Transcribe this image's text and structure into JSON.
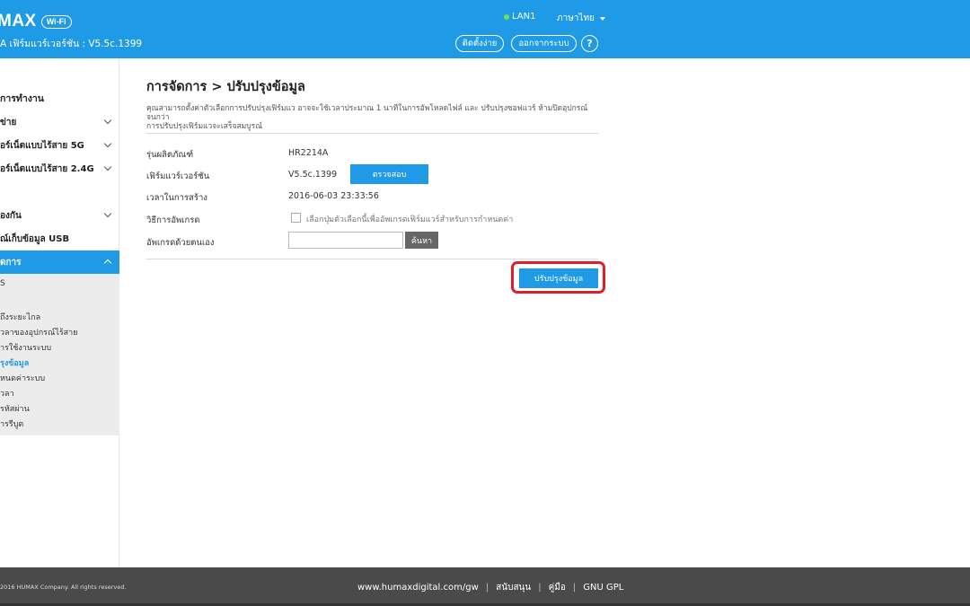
{
  "header": {
    "logo": "HUMAX",
    "logo_visible": "MAX",
    "wifi_badge": "Wi-Fi",
    "firmware_line": "A เฟิร์มแวร์เวอร์ชัน : V5.5c.1399",
    "lan_label": "LAN1",
    "language": "ภาษาไทย",
    "setup_button": "ติดตั้งง่าย",
    "logout_button": "ออกจากระบบ",
    "help_button": "?",
    "colors": {
      "primary": "#1e9ae6",
      "lan_status": "#6ee24a"
    }
  },
  "sidebar": {
    "group_title": "การทำงาน",
    "items": [
      {
        "label": "ข่าย"
      },
      {
        "label": "อร์เน็ตแบบไร้สาย 5G"
      },
      {
        "label": "อร์เน็ตแบบไร้สาย 2.4G"
      },
      {
        "label": "องกัน"
      },
      {
        "label": "ณ์เก็บข้อมูล USB"
      },
      {
        "label": "ดการ"
      }
    ],
    "submenu": [
      "S",
      "",
      "ถึงระยะไกล",
      "วลาของอุปกรณ์ไร้สาย",
      "ารใช้งานระบบ",
      "รุงข้อมูล",
      "หนดค่าระบบ",
      "วลา",
      "รหัสผ่าน",
      "ารรีบูต"
    ]
  },
  "main": {
    "title": "การจัดการ > ปรับปรุงข้อมูล",
    "description_1": "คุณสามารถตั้งค่าตัวเลือกการปรับปรุงเฟิร์มแว อาจจะใช้เวลาประมาณ 1 นาทีในการอัพโหลดไฟล์ และ ปรับปรุงซอฟแวร์ ห้ามปิดอุปกรณ์จนกว่า",
    "description_2": "การปรับปรุงเฟิร์มแวจะเสร็จสมบูรณ์",
    "model_label": "รุ่นผลิตภัณฑ์",
    "model_value": "HR2214A",
    "firmware_label": "เฟิร์มแวร์เวอร์ชัน",
    "firmware_value": "V5.5c.1399",
    "check_button": "ตรวจสอบ",
    "build_time_label": "เวลาในการสร้าง",
    "build_time_value": "2016-06-03 23:33:56",
    "upgrade_method_label": "วิธีการอัพเกรด",
    "auto_upgrade_text": "เลือกปุ่มตัวเลือกนี้เพื่ออัพเกรดเฟิร์มแวร์สำหรับการกำหนดค่า",
    "manual_upgrade_label": "อัพเกรดด้วยตนเอง",
    "file_value": "",
    "browse_button": "ค้นหา",
    "update_button": "ปรับปรุงข้อมูล",
    "highlight_color": "#e01e2a"
  },
  "footer": {
    "copyright": "2016 HUMAX Company. All rights reserved.",
    "website": "www.humaxdigital.com/gw",
    "support": "สนับสนุน",
    "manual": "คู่มือ",
    "gpl": "GNU GPL"
  }
}
